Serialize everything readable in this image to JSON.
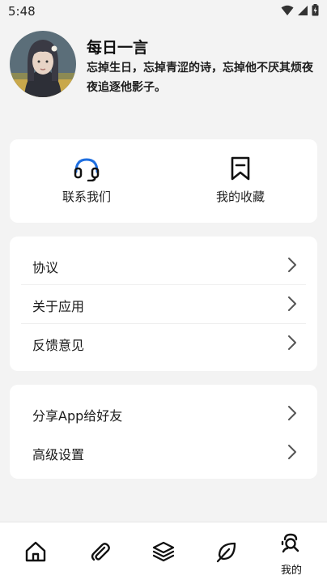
{
  "status_bar": {
    "time": "5:48"
  },
  "profile": {
    "name": "每日一言",
    "quote": "忘掉生日，忘掉青涩的诗，忘掉他不厌其烦夜夜追逐他影子。"
  },
  "quick_actions": [
    {
      "label": "联系我们",
      "icon": "headset-icon"
    },
    {
      "label": "我的收藏",
      "icon": "bookmark-icon"
    }
  ],
  "menu_group_1": [
    {
      "label": "协议"
    },
    {
      "label": "关于应用"
    },
    {
      "label": "反馈意见"
    }
  ],
  "menu_group_2": [
    {
      "label": "分享App给好友"
    },
    {
      "label": "高级设置"
    }
  ],
  "bottom_nav": {
    "items": [
      {
        "icon": "home-icon"
      },
      {
        "icon": "paperclip-icon"
      },
      {
        "icon": "layers-icon"
      },
      {
        "icon": "leaf-icon"
      },
      {
        "icon": "profile-search-icon",
        "label": "我的",
        "active": true
      }
    ]
  },
  "colors": {
    "accent": "#1f6fe0",
    "background": "#f3f3f3",
    "card": "#ffffff"
  }
}
